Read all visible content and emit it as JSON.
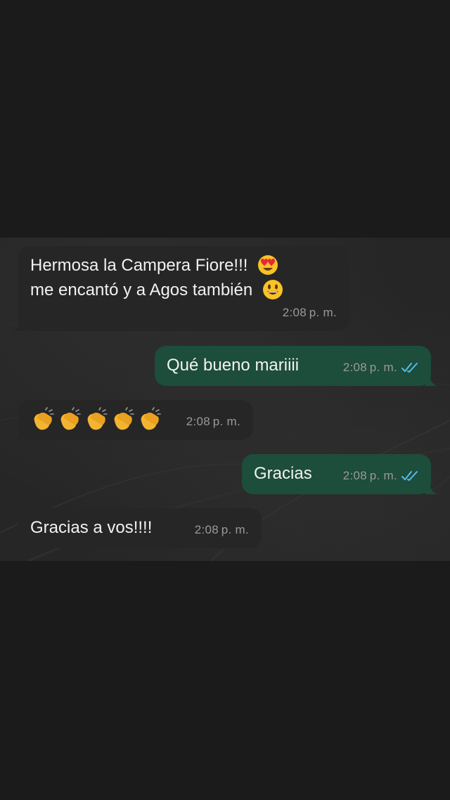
{
  "messages": [
    {
      "direction": "incoming",
      "line1": "Hermosa la Campera Fiore!!!",
      "line1_emoji": "heart-eyes-emoji",
      "line2": "me encantó y a Agos también",
      "line2_emoji": "grinning-face-emoji",
      "time": "2:08 p. m."
    },
    {
      "direction": "outgoing",
      "text": "Qué bueno mariiii",
      "time": "2:08 p. m.",
      "status": "read-double-check"
    },
    {
      "direction": "incoming",
      "emoji": "clapping-hands-emoji",
      "emoji_count": 5,
      "time": "2:08 p. m."
    },
    {
      "direction": "outgoing",
      "text": "Gracias",
      "time": "2:08 p. m.",
      "status": "read-double-check"
    },
    {
      "direction": "incoming",
      "text": "Gracias a vos!!!!",
      "time": "2:08 p. m."
    }
  ],
  "colors": {
    "page_background": "#1b1b1b",
    "incoming_bubble": "#262626",
    "outgoing_bubble": "#1d4d3b",
    "text": "#f2f2f2",
    "timestamp": "#9a9a9a",
    "read_ticks": "#53bdeb"
  }
}
